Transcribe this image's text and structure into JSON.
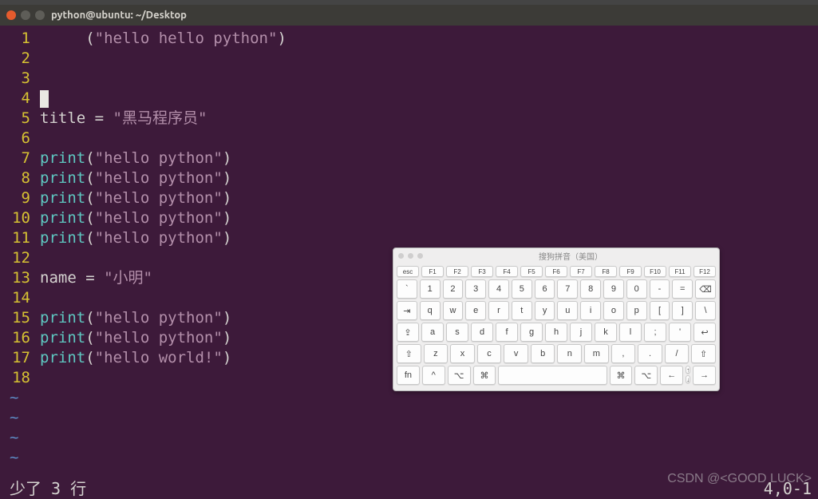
{
  "window": {
    "title": "python@ubuntu: ~/Desktop"
  },
  "editor": {
    "lines": [
      {
        "num": "1",
        "parts": [
          {
            "cls": "plain",
            "t": "     "
          },
          {
            "cls": "paren",
            "t": "("
          },
          {
            "cls": "str",
            "t": "\"hello hello python\""
          },
          {
            "cls": "paren",
            "t": ")"
          }
        ]
      },
      {
        "num": "2",
        "parts": []
      },
      {
        "num": "3",
        "parts": []
      },
      {
        "num": "4",
        "cursor": true,
        "parts": []
      },
      {
        "num": "5",
        "parts": [
          {
            "cls": "plain",
            "t": "title = "
          },
          {
            "cls": "str",
            "t": "\"黑马程序员\""
          }
        ]
      },
      {
        "num": "6",
        "parts": []
      },
      {
        "num": "7",
        "parts": [
          {
            "cls": "kw",
            "t": "print"
          },
          {
            "cls": "paren",
            "t": "("
          },
          {
            "cls": "str",
            "t": "\"hello python\""
          },
          {
            "cls": "paren",
            "t": ")"
          }
        ]
      },
      {
        "num": "8",
        "parts": [
          {
            "cls": "kw",
            "t": "print"
          },
          {
            "cls": "paren",
            "t": "("
          },
          {
            "cls": "str",
            "t": "\"hello python\""
          },
          {
            "cls": "paren",
            "t": ")"
          }
        ]
      },
      {
        "num": "9",
        "parts": [
          {
            "cls": "kw",
            "t": "print"
          },
          {
            "cls": "paren",
            "t": "("
          },
          {
            "cls": "str",
            "t": "\"hello python\""
          },
          {
            "cls": "paren",
            "t": ")"
          }
        ]
      },
      {
        "num": "10",
        "parts": [
          {
            "cls": "kw",
            "t": "print"
          },
          {
            "cls": "paren",
            "t": "("
          },
          {
            "cls": "str",
            "t": "\"hello python\""
          },
          {
            "cls": "paren",
            "t": ")"
          }
        ]
      },
      {
        "num": "11",
        "parts": [
          {
            "cls": "kw",
            "t": "print"
          },
          {
            "cls": "paren",
            "t": "("
          },
          {
            "cls": "str",
            "t": "\"hello python\""
          },
          {
            "cls": "paren",
            "t": ")"
          }
        ]
      },
      {
        "num": "12",
        "parts": []
      },
      {
        "num": "13",
        "parts": [
          {
            "cls": "plain",
            "t": "name = "
          },
          {
            "cls": "str",
            "t": "\"小明\""
          }
        ]
      },
      {
        "num": "14",
        "parts": []
      },
      {
        "num": "15",
        "parts": [
          {
            "cls": "kw",
            "t": "print"
          },
          {
            "cls": "paren",
            "t": "("
          },
          {
            "cls": "str",
            "t": "\"hello python\""
          },
          {
            "cls": "paren",
            "t": ")"
          }
        ]
      },
      {
        "num": "16",
        "parts": [
          {
            "cls": "kw",
            "t": "print"
          },
          {
            "cls": "paren",
            "t": "("
          },
          {
            "cls": "str",
            "t": "\"hello python\""
          },
          {
            "cls": "paren",
            "t": ")"
          }
        ]
      },
      {
        "num": "17",
        "parts": [
          {
            "cls": "kw",
            "t": "print"
          },
          {
            "cls": "paren",
            "t": "("
          },
          {
            "cls": "str",
            "t": "\"hello world!\""
          },
          {
            "cls": "paren",
            "t": ")"
          }
        ]
      },
      {
        "num": "18",
        "parts": []
      }
    ],
    "tilde_count": 4,
    "status_left": "少了 3 行",
    "status_right": "4,0-1"
  },
  "keyboard": {
    "title": "搜狗拼音（美国）",
    "rows": {
      "fn": [
        "esc",
        "F1",
        "F2",
        "F3",
        "F4",
        "F5",
        "F6",
        "F7",
        "F8",
        "F9",
        "F10",
        "F11",
        "F12"
      ],
      "num": [
        "`",
        "1",
        "2",
        "3",
        "4",
        "5",
        "6",
        "7",
        "8",
        "9",
        "0",
        "-",
        "="
      ],
      "qwer": [
        "q",
        "w",
        "e",
        "r",
        "t",
        "y",
        "u",
        "i",
        "o",
        "p",
        "[",
        "]",
        "\\"
      ],
      "asdf": [
        "a",
        "s",
        "d",
        "f",
        "g",
        "h",
        "j",
        "k",
        "l",
        ";",
        "'"
      ],
      "zxcv": [
        "z",
        "x",
        "c",
        "v",
        "b",
        "n",
        "m",
        ",",
        ".",
        "/"
      ],
      "bottom_left": [
        "fn",
        "^",
        "⌥",
        "⌘"
      ],
      "bottom_right": [
        "⌘",
        "⌥"
      ],
      "arrows": [
        "↑",
        "←",
        "↓",
        "→"
      ]
    },
    "special": {
      "backspace": "⌫",
      "tab": "⇥",
      "caps": "⇪",
      "enter": "↩",
      "shift": "⇧"
    }
  },
  "watermark": "CSDN @<GOOD LUCK>"
}
